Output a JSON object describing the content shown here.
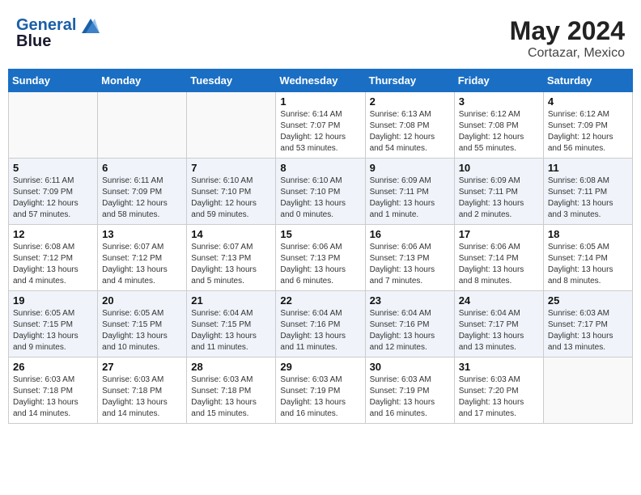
{
  "header": {
    "logo_line1": "General",
    "logo_line2": "Blue",
    "month_year": "May 2024",
    "location": "Cortazar, Mexico"
  },
  "days_of_week": [
    "Sunday",
    "Monday",
    "Tuesday",
    "Wednesday",
    "Thursday",
    "Friday",
    "Saturday"
  ],
  "weeks": [
    [
      {
        "day": "",
        "info": ""
      },
      {
        "day": "",
        "info": ""
      },
      {
        "day": "",
        "info": ""
      },
      {
        "day": "1",
        "info": "Sunrise: 6:14 AM\nSunset: 7:07 PM\nDaylight: 12 hours\nand 53 minutes."
      },
      {
        "day": "2",
        "info": "Sunrise: 6:13 AM\nSunset: 7:08 PM\nDaylight: 12 hours\nand 54 minutes."
      },
      {
        "day": "3",
        "info": "Sunrise: 6:12 AM\nSunset: 7:08 PM\nDaylight: 12 hours\nand 55 minutes."
      },
      {
        "day": "4",
        "info": "Sunrise: 6:12 AM\nSunset: 7:09 PM\nDaylight: 12 hours\nand 56 minutes."
      }
    ],
    [
      {
        "day": "5",
        "info": "Sunrise: 6:11 AM\nSunset: 7:09 PM\nDaylight: 12 hours\nand 57 minutes."
      },
      {
        "day": "6",
        "info": "Sunrise: 6:11 AM\nSunset: 7:09 PM\nDaylight: 12 hours\nand 58 minutes."
      },
      {
        "day": "7",
        "info": "Sunrise: 6:10 AM\nSunset: 7:10 PM\nDaylight: 12 hours\nand 59 minutes."
      },
      {
        "day": "8",
        "info": "Sunrise: 6:10 AM\nSunset: 7:10 PM\nDaylight: 13 hours\nand 0 minutes."
      },
      {
        "day": "9",
        "info": "Sunrise: 6:09 AM\nSunset: 7:11 PM\nDaylight: 13 hours\nand 1 minute."
      },
      {
        "day": "10",
        "info": "Sunrise: 6:09 AM\nSunset: 7:11 PM\nDaylight: 13 hours\nand 2 minutes."
      },
      {
        "day": "11",
        "info": "Sunrise: 6:08 AM\nSunset: 7:11 PM\nDaylight: 13 hours\nand 3 minutes."
      }
    ],
    [
      {
        "day": "12",
        "info": "Sunrise: 6:08 AM\nSunset: 7:12 PM\nDaylight: 13 hours\nand 4 minutes."
      },
      {
        "day": "13",
        "info": "Sunrise: 6:07 AM\nSunset: 7:12 PM\nDaylight: 13 hours\nand 4 minutes."
      },
      {
        "day": "14",
        "info": "Sunrise: 6:07 AM\nSunset: 7:13 PM\nDaylight: 13 hours\nand 5 minutes."
      },
      {
        "day": "15",
        "info": "Sunrise: 6:06 AM\nSunset: 7:13 PM\nDaylight: 13 hours\nand 6 minutes."
      },
      {
        "day": "16",
        "info": "Sunrise: 6:06 AM\nSunset: 7:13 PM\nDaylight: 13 hours\nand 7 minutes."
      },
      {
        "day": "17",
        "info": "Sunrise: 6:06 AM\nSunset: 7:14 PM\nDaylight: 13 hours\nand 8 minutes."
      },
      {
        "day": "18",
        "info": "Sunrise: 6:05 AM\nSunset: 7:14 PM\nDaylight: 13 hours\nand 8 minutes."
      }
    ],
    [
      {
        "day": "19",
        "info": "Sunrise: 6:05 AM\nSunset: 7:15 PM\nDaylight: 13 hours\nand 9 minutes."
      },
      {
        "day": "20",
        "info": "Sunrise: 6:05 AM\nSunset: 7:15 PM\nDaylight: 13 hours\nand 10 minutes."
      },
      {
        "day": "21",
        "info": "Sunrise: 6:04 AM\nSunset: 7:15 PM\nDaylight: 13 hours\nand 11 minutes."
      },
      {
        "day": "22",
        "info": "Sunrise: 6:04 AM\nSunset: 7:16 PM\nDaylight: 13 hours\nand 11 minutes."
      },
      {
        "day": "23",
        "info": "Sunrise: 6:04 AM\nSunset: 7:16 PM\nDaylight: 13 hours\nand 12 minutes."
      },
      {
        "day": "24",
        "info": "Sunrise: 6:04 AM\nSunset: 7:17 PM\nDaylight: 13 hours\nand 13 minutes."
      },
      {
        "day": "25",
        "info": "Sunrise: 6:03 AM\nSunset: 7:17 PM\nDaylight: 13 hours\nand 13 minutes."
      }
    ],
    [
      {
        "day": "26",
        "info": "Sunrise: 6:03 AM\nSunset: 7:18 PM\nDaylight: 13 hours\nand 14 minutes."
      },
      {
        "day": "27",
        "info": "Sunrise: 6:03 AM\nSunset: 7:18 PM\nDaylight: 13 hours\nand 14 minutes."
      },
      {
        "day": "28",
        "info": "Sunrise: 6:03 AM\nSunset: 7:18 PM\nDaylight: 13 hours\nand 15 minutes."
      },
      {
        "day": "29",
        "info": "Sunrise: 6:03 AM\nSunset: 7:19 PM\nDaylight: 13 hours\nand 16 minutes."
      },
      {
        "day": "30",
        "info": "Sunrise: 6:03 AM\nSunset: 7:19 PM\nDaylight: 13 hours\nand 16 minutes."
      },
      {
        "day": "31",
        "info": "Sunrise: 6:03 AM\nSunset: 7:20 PM\nDaylight: 13 hours\nand 17 minutes."
      },
      {
        "day": "",
        "info": ""
      }
    ]
  ]
}
